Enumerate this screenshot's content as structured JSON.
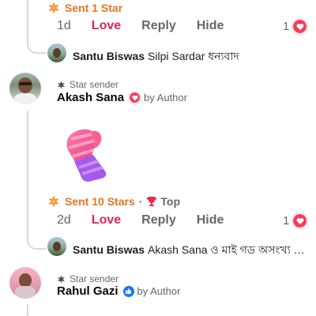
{
  "comments": [
    {
      "stars_text": "Sent 1 Star",
      "actions": {
        "time": "1d",
        "love": "Love",
        "reply": "Reply",
        "hide": "Hide"
      },
      "reaction_count": "1",
      "reply_preview": {
        "name": "Santu Biswas",
        "text": "Silpi Sardar ধন্যবাদ"
      }
    },
    {
      "badge": "Star sender",
      "name": "Akash Sana",
      "by": "by Author",
      "stars_text": "Sent 10 Stars",
      "separator": "·",
      "top_label": "Top",
      "actions": {
        "time": "2d",
        "love": "Love",
        "reply": "Reply",
        "hide": "Hide"
      },
      "reaction_count": "1",
      "reply_preview": {
        "name": "Santu Biswas",
        "text": "Akash Sana ও মাই গড অসংখ্য অ..."
      }
    },
    {
      "badge": "Star sender",
      "name": "Rahul Gazi",
      "by": "by Author"
    }
  ],
  "colors": {
    "star_orange": "#e67320",
    "love_red": "#e0245e",
    "heart_badge": "#f33e58",
    "like_blue": "#1877f2",
    "thread_line": "#d7dbe0"
  },
  "icons": [
    "star-burst-icon",
    "heart-badge-icon",
    "trophy-icon",
    "like-thumb-icon",
    "small-star-icon",
    "mitten-sticker"
  ]
}
